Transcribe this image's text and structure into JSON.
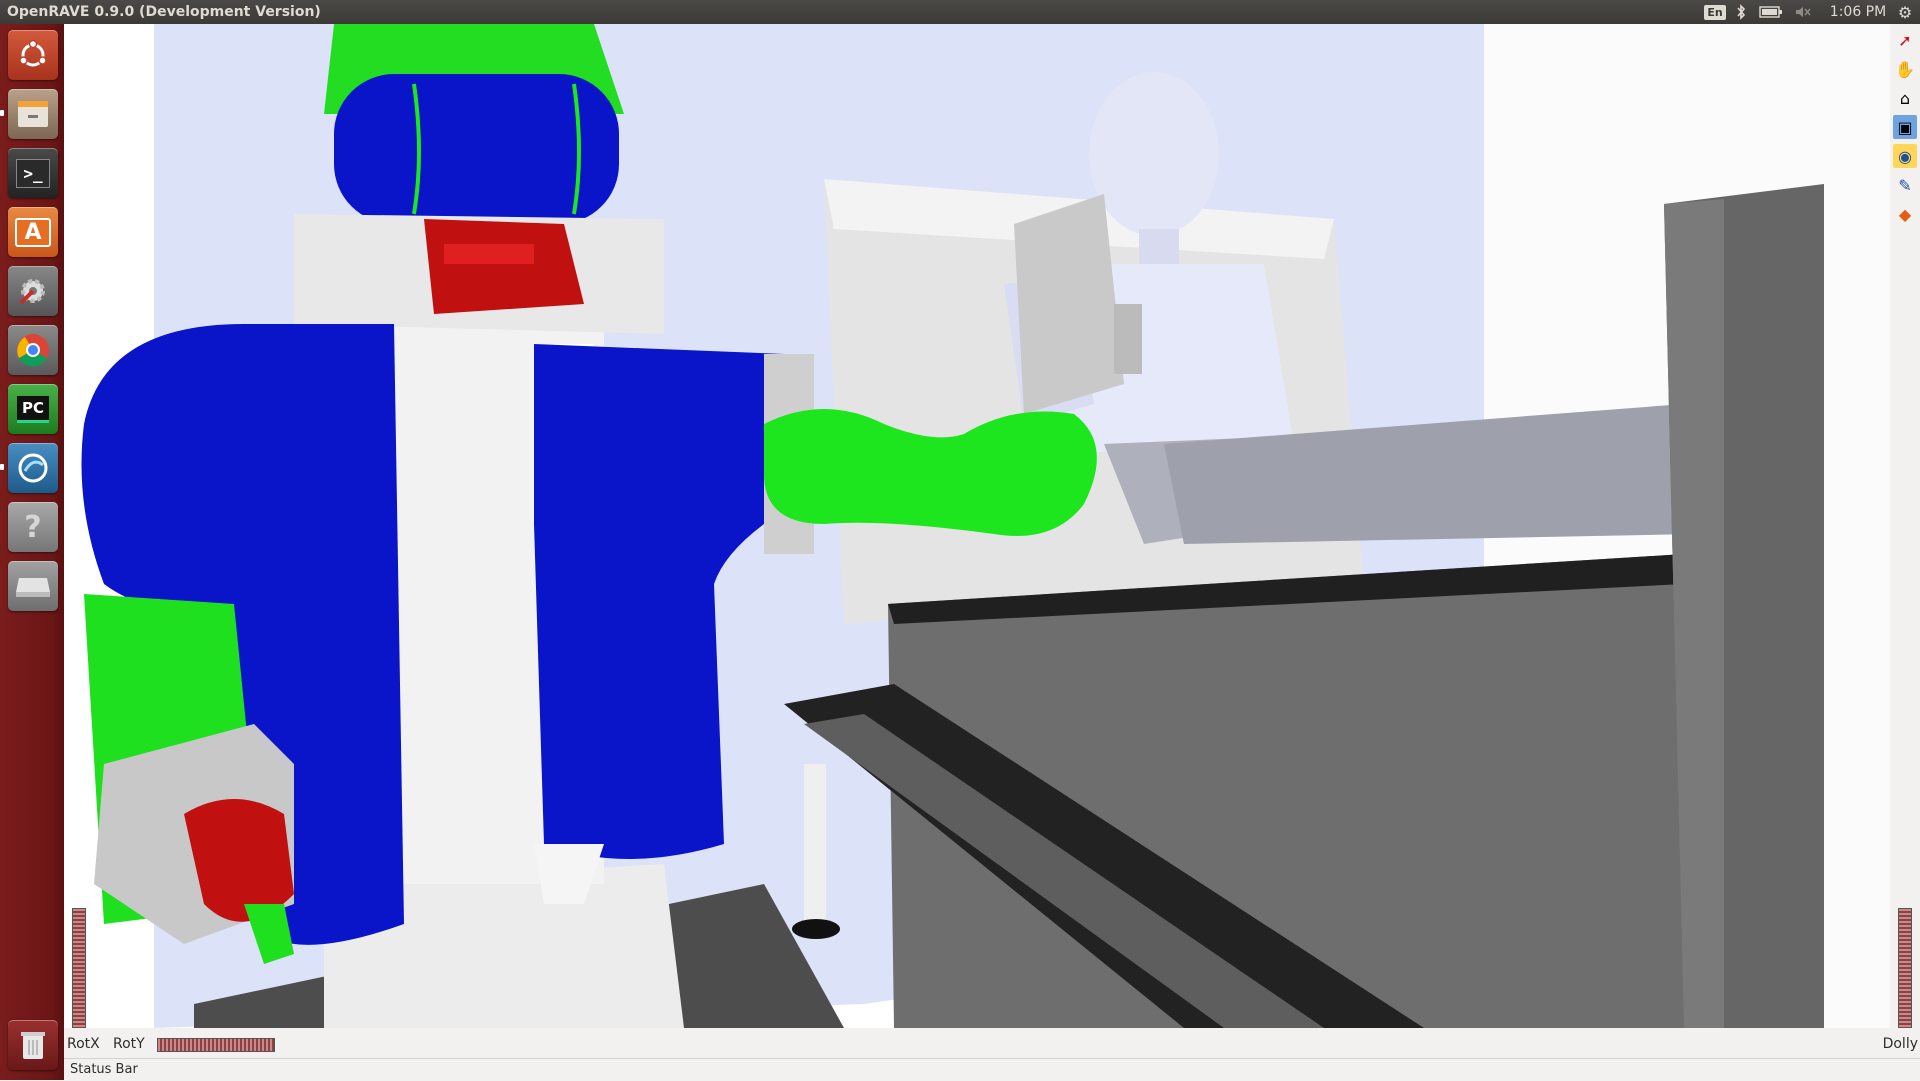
{
  "topbar": {
    "app_title": "OpenRAVE 0.9.0 (Development Version)",
    "keyboard_layout": "En",
    "clock": "1:06 PM",
    "icons": [
      "bluetooth-icon",
      "battery-icon",
      "volume-muted-icon",
      "settings-gear-icon"
    ]
  },
  "launcher": {
    "items": [
      {
        "name": "ubuntu-dash",
        "icon": "ubuntu-logo-icon",
        "color": "#c1402c"
      },
      {
        "name": "files",
        "icon": "file-cabinet-icon",
        "color": "#8a7561"
      },
      {
        "name": "terminal",
        "icon": "terminal-icon",
        "color": "#3a3a3a"
      },
      {
        "name": "software-center",
        "icon": "shopping-bag-icon",
        "color": "#e0691f"
      },
      {
        "name": "system-settings",
        "icon": "wrench-gear-icon",
        "color": "#6e6e6e"
      },
      {
        "name": "chrome",
        "icon": "chrome-icon",
        "color": "#3d7bd6"
      },
      {
        "name": "pycharm",
        "icon": "pycharm-icon",
        "color": "#3a9e3a"
      },
      {
        "name": "unknown-app",
        "icon": "app-circle-icon",
        "color": "#2d73a8"
      },
      {
        "name": "help",
        "icon": "question-mark-icon",
        "color": "#9a9a9a"
      },
      {
        "name": "disk",
        "icon": "drive-icon",
        "color": "#8d8d8d"
      },
      {
        "name": "trash",
        "icon": "trash-icon",
        "color": "#8b2525"
      }
    ],
    "terminal_glyph": ">_",
    "software_glyph": "A",
    "pycharm_glyph": "PC",
    "help_glyph": "?"
  },
  "viewer_tools": [
    "select-arrow-icon",
    "hand-icon",
    "home-icon",
    "view-all-icon",
    "eye-icon",
    "paint-icon",
    "render-cube-icon"
  ],
  "colors": {
    "robot_blue": "#0a14c8",
    "robot_green": "#1ee61e",
    "robot_red": "#d01010",
    "robot_gray": "#c8c8c8",
    "human_lavender": "#dcdff5",
    "background_lavender": "#dce2f8"
  },
  "controls": {
    "rotx_label": "RotX",
    "roty_label": "RotY",
    "dolly_label": "Dolly"
  },
  "status": {
    "text": "Status Bar"
  }
}
